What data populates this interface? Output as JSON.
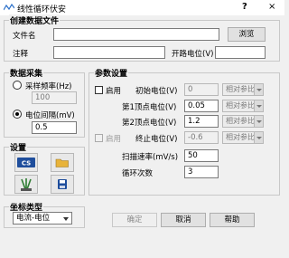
{
  "window": {
    "title": "线性循环伏安",
    "help": "?",
    "close": "×"
  },
  "create_file": {
    "group_title": "创建数据文件",
    "filename_label": "文件名",
    "filename_value": "",
    "browse_label": "浏览",
    "comment_label": "注释",
    "comment_value": "",
    "open_potential_label": "开路电位(V)",
    "open_potential_value": ""
  },
  "acquisition": {
    "group_title": "数据采集",
    "sample_freq_label": "采样频率(Hz)",
    "sample_freq_value": "100",
    "potential_interval_label": "电位间隔(mV)",
    "potential_interval_value": "0.5"
  },
  "settings": {
    "group_title": "设置",
    "cs_label": "CS"
  },
  "coord": {
    "group_title": "坐标类型",
    "selected": "电流-电位"
  },
  "params": {
    "group_title": "参数设置",
    "enable_label": "启用",
    "initial_label": "初始电位(V)",
    "initial_value": "0",
    "initial_ref": "相对参比",
    "vertex1_label": "第1顶点电位(V)",
    "vertex1_value": "0.05",
    "vertex1_ref": "相对参比",
    "vertex2_label": "第2顶点电位(V)",
    "vertex2_value": "1.2",
    "vertex2_ref": "相对参比",
    "enable2_label": "启用",
    "final_label": "终止电位(V)",
    "final_value": "-0.6",
    "final_ref": "相对参比",
    "scan_rate_label": "扫描速率(mV/s)",
    "scan_rate_value": "50",
    "cycles_label": "循环次数",
    "cycles_value": "3"
  },
  "footer": {
    "ok": "确定",
    "cancel": "取消",
    "help": "帮助"
  },
  "colors": {
    "cs_blue": "#1f4e9c",
    "accent": "#2e7d32"
  }
}
